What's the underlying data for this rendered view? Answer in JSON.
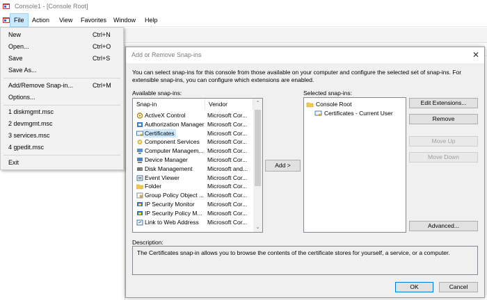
{
  "window": {
    "title": "Console1 - [Console Root]"
  },
  "menubar": {
    "items": [
      {
        "label": "File"
      },
      {
        "label": "Action"
      },
      {
        "label": "View"
      },
      {
        "label": "Favorites"
      },
      {
        "label": "Window"
      },
      {
        "label": "Help"
      }
    ]
  },
  "file_menu": {
    "items": [
      {
        "label": "New",
        "shortcut": "Ctrl+N"
      },
      {
        "label": "Open...",
        "shortcut": "Ctrl+O"
      },
      {
        "label": "Save",
        "shortcut": "Ctrl+S"
      },
      {
        "label": "Save As...",
        "shortcut": ""
      },
      {
        "label": "Add/Remove Snap-in...",
        "shortcut": "Ctrl+M"
      },
      {
        "label": "Options...",
        "shortcut": ""
      },
      {
        "label": "1 diskmgmt.msc",
        "shortcut": ""
      },
      {
        "label": "2 devmgmt.msc",
        "shortcut": ""
      },
      {
        "label": "3 services.msc",
        "shortcut": ""
      },
      {
        "label": "4 gpedit.msc",
        "shortcut": ""
      },
      {
        "label": "Exit",
        "shortcut": ""
      }
    ]
  },
  "dialog": {
    "title": "Add or Remove Snap-ins",
    "intro": "You can select snap-ins for this console from those available on your computer and configure the selected set of snap-ins. For extensible snap-ins, you can configure which extensions are enabled.",
    "available_label": "Available snap-ins:",
    "columns": {
      "snapin": "Snap-in",
      "vendor": "Vendor"
    },
    "available": [
      {
        "name": "ActiveX Control",
        "vendor": "Microsoft Cor...",
        "icon": "activex-icon"
      },
      {
        "name": "Authorization Manager",
        "vendor": "Microsoft Cor...",
        "icon": "authorization-icon"
      },
      {
        "name": "Certificates",
        "vendor": "Microsoft Cor...",
        "icon": "certificate-icon"
      },
      {
        "name": "Component Services",
        "vendor": "Microsoft Cor...",
        "icon": "component-icon"
      },
      {
        "name": "Computer Managem...",
        "vendor": "Microsoft Cor...",
        "icon": "computer-icon"
      },
      {
        "name": "Device Manager",
        "vendor": "Microsoft Cor...",
        "icon": "device-icon"
      },
      {
        "name": "Disk Management",
        "vendor": "Microsoft and...",
        "icon": "disk-icon"
      },
      {
        "name": "Event Viewer",
        "vendor": "Microsoft Cor...",
        "icon": "event-icon"
      },
      {
        "name": "Folder",
        "vendor": "Microsoft Cor...",
        "icon": "folder-icon"
      },
      {
        "name": "Group Policy Object ...",
        "vendor": "Microsoft Cor...",
        "icon": "policy-icon"
      },
      {
        "name": "IP Security Monitor",
        "vendor": "Microsoft Cor...",
        "icon": "ipsec-icon"
      },
      {
        "name": "IP Security Policy M...",
        "vendor": "Microsoft Cor...",
        "icon": "ipsec-icon"
      },
      {
        "name": "Link to Web Address",
        "vendor": "Microsoft Cor...",
        "icon": "link-icon"
      }
    ],
    "selected_index": 2,
    "add_button": "Add >",
    "selected_label": "Selected snap-ins:",
    "tree": {
      "root": "Console Root",
      "child": "Certificates - Current User"
    },
    "buttons": {
      "edit_extensions": "Edit Extensions...",
      "remove": "Remove",
      "move_up": "Move Up",
      "move_down": "Move Down",
      "advanced": "Advanced..."
    },
    "description_label": "Description:",
    "description": "The Certificates snap-in allows you to browse the contents of the certificate stores for yourself, a service, or a computer.",
    "ok": "OK",
    "cancel": "Cancel"
  }
}
